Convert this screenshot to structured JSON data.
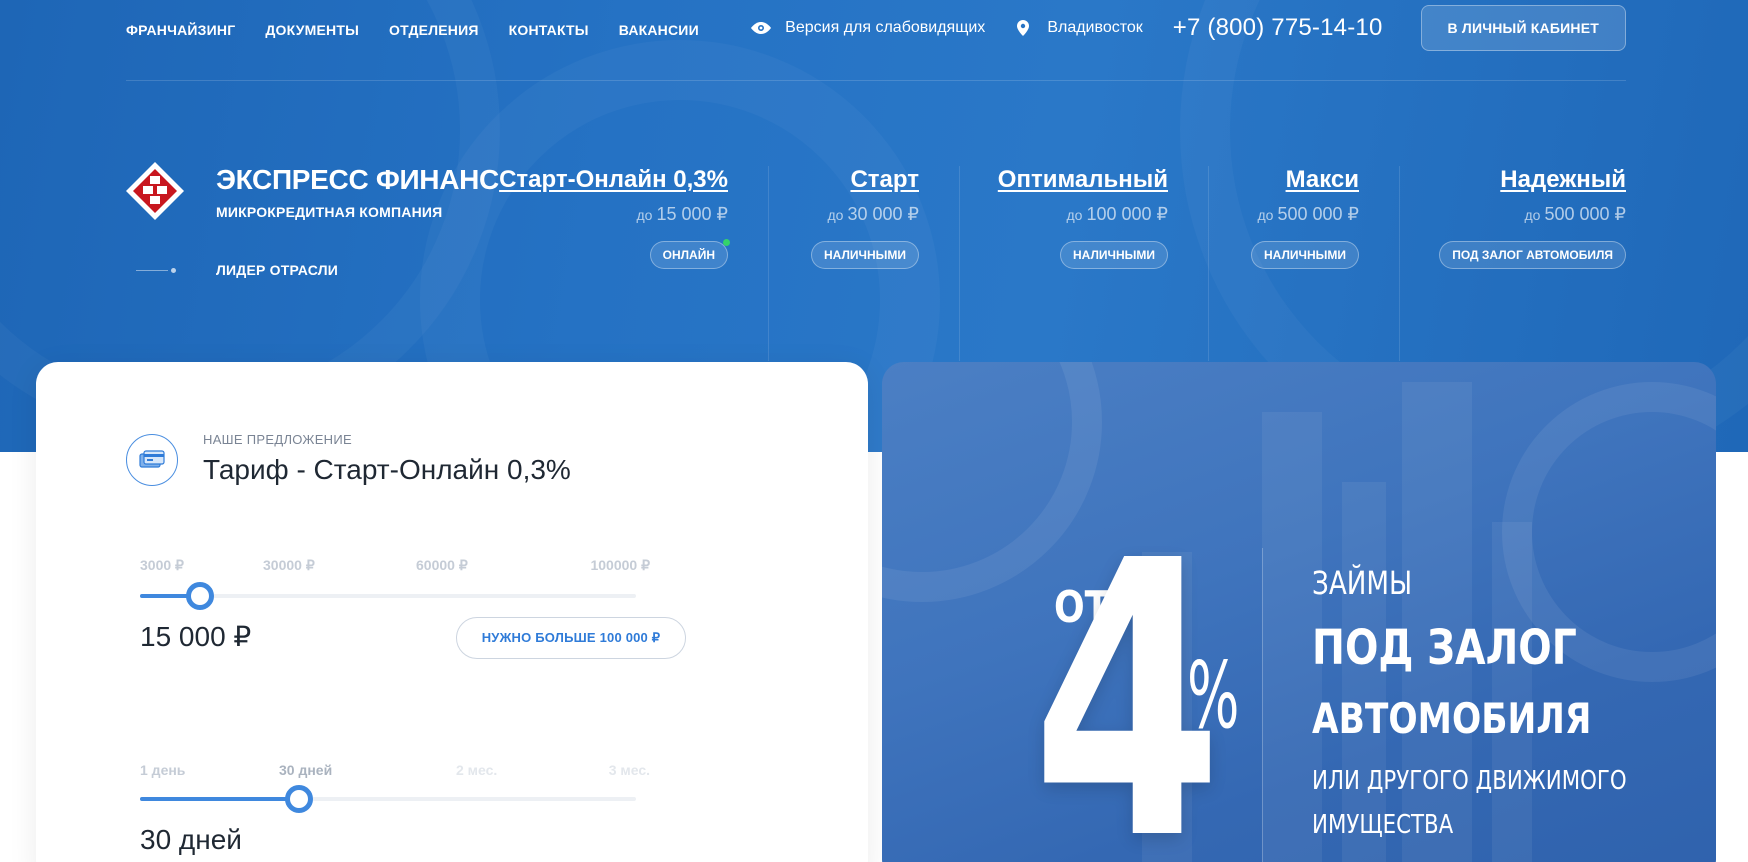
{
  "nav": {
    "items": [
      "ФРАНЧАЙЗИНГ",
      "ДОКУМЕНТЫ",
      "ОТДЕЛЕНИЯ",
      "КОНТАКТЫ",
      "ВАКАНСИИ"
    ],
    "vision_label": "Версия для слабовидящих",
    "city": "Владивосток",
    "phone": "+7 (800) 775-14-10",
    "cabinet_button": "В ЛИЧНЫЙ КАБИНЕТ"
  },
  "brand": {
    "name": "ЭКСПРЕСС ФИНАНС",
    "subtitle": "МИКРОКРЕДИТНАЯ КОМПАНИЯ",
    "tagline": "ЛИДЕР ОТРАСЛИ",
    "logo_colors": {
      "outer": "#ffffff",
      "inner": "#c8171f"
    }
  },
  "tariffs": [
    {
      "name": "Старт-Онлайн 0,3%",
      "prefix": "до",
      "amount": "15 000 ₽",
      "badge": "ОНЛАЙН",
      "online": true
    },
    {
      "name": "Старт",
      "prefix": "до",
      "amount": "30 000 ₽",
      "badge": "НАЛИЧНЫМИ",
      "online": false
    },
    {
      "name": "Оптимальный",
      "prefix": "до",
      "amount": "100 000 ₽",
      "badge": "НАЛИЧНЫМИ",
      "online": false
    },
    {
      "name": "Макси",
      "prefix": "до",
      "amount": "500 000 ₽",
      "badge": "НАЛИЧНЫМИ",
      "online": false
    },
    {
      "name": "Надежный",
      "prefix": "до",
      "amount": "500 000 ₽",
      "badge": "ПОД ЗАЛОГ АВТОМОБИЛЯ",
      "online": false
    }
  ],
  "offer": {
    "label": "НАШЕ ПРЕДЛОЖЕНИЕ",
    "title": "Тариф - Старт-Онлайн 0,3%",
    "icon": "credit-card-icon"
  },
  "amount_slider": {
    "ticks": [
      "3000 ₽",
      "30000 ₽",
      "60000 ₽",
      "100000 ₽"
    ],
    "value": "15 000 ₽",
    "position": 0.12,
    "more_button": "НУЖНО БОЛЬШЕ 100 000 ₽"
  },
  "term_slider": {
    "ticks": [
      "1 день",
      "30 дней",
      "2 мес.",
      "3 мес."
    ],
    "value": "30 дней",
    "position": 0.32
  },
  "promo": {
    "from": "ОТ",
    "number": "4",
    "percent": "%",
    "line1": "ЗАЙМЫ",
    "line2": "ПОД ЗАЛОГ",
    "line3": "АВТОМОБИЛЯ",
    "line4": "ИЛИ ДРУГОГО ДВИЖИМОГО",
    "line5": "ИМУЩЕСТВА"
  },
  "colors": {
    "brand_blue": "#2572c4",
    "accent": "#3f88de",
    "online_dot": "#34d36a"
  }
}
